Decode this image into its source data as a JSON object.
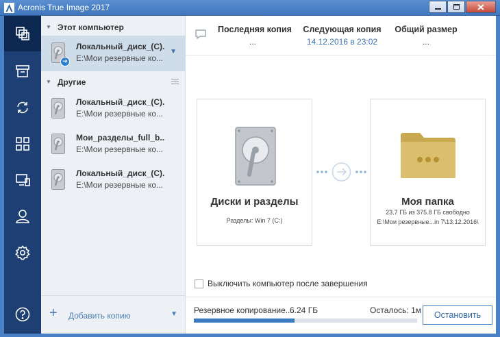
{
  "window": {
    "title": "Acronis True Image 2017"
  },
  "nav": [
    "backup-icon",
    "archive-icon",
    "sync-icon",
    "dashboard-icon",
    "devices-icon",
    "account-icon",
    "settings-icon",
    "help-icon"
  ],
  "list": {
    "group_this_pc": "Этот компьютер",
    "group_other": "Другие",
    "items": [
      {
        "name": "Локальный_диск_(C)...",
        "path": "E:\\Мои резервные ко..."
      },
      {
        "name": "Локальный_диск_(C)...",
        "path": "E:\\Мои резервные ко..."
      },
      {
        "name": "Мои_разделы_full_b...",
        "path": "E:\\Мои резервные ко..."
      },
      {
        "name": "Локальный_диск_(C)...",
        "path": "E:\\Мои резервные ко..."
      }
    ],
    "add_backup": "Добавить копию"
  },
  "header": {
    "last_copy_label": "Последняя копия",
    "last_copy_value": "...",
    "next_copy_label": "Следующая копия",
    "next_copy_value": "14.12.2016 в 23:02",
    "total_size_label": "Общий размер",
    "total_size_value": "..."
  },
  "source": {
    "title": "Диски и разделы",
    "sub": "Разделы: Win 7 (C:)"
  },
  "destination": {
    "title": "Моя папка",
    "sub1": "23.7 ГБ из 375.8 ГБ свободно",
    "sub2": "E:\\Мои резервные...in 7\\13.12.2016\\"
  },
  "options": {
    "shutdown_label": "Выключить компьютер после завершения"
  },
  "progress": {
    "label": "Резервное копирование...",
    "size": "6.24 ГБ",
    "remaining": "Осталось: 1м",
    "fraction": 0.45,
    "stop_label": "Остановить"
  },
  "colors": {
    "nav_bg": "#1d3f74",
    "accent": "#3b79c2",
    "folder": "#d6b96a"
  }
}
